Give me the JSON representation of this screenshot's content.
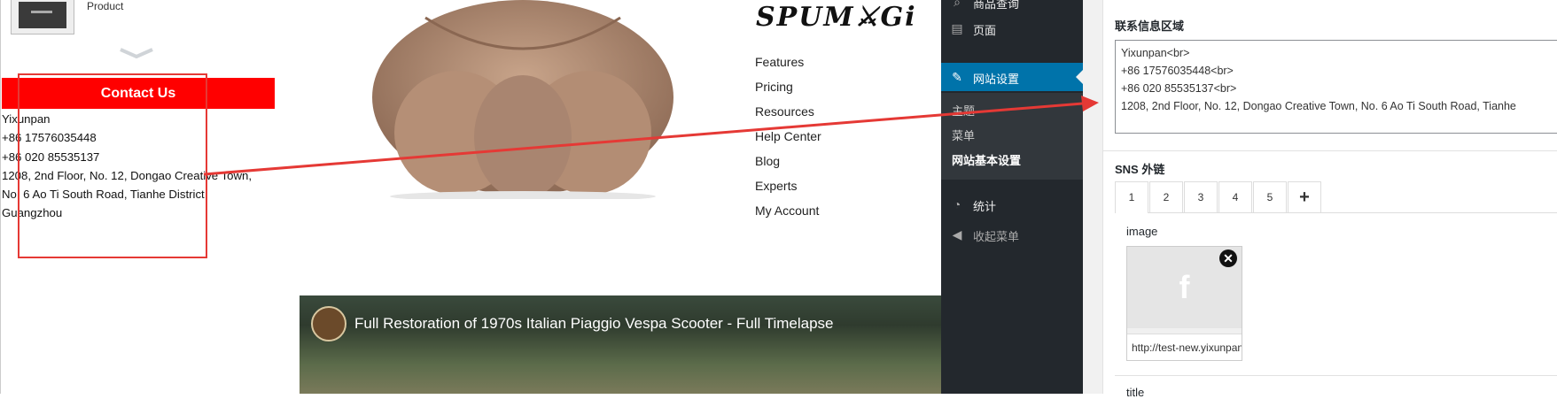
{
  "frontend": {
    "product_label": "Product",
    "contact_title": "Contact Us",
    "contact_lines": [
      "Yixunpan",
      "+86 17576035448",
      "+86 020 85535137",
      "1208, 2nd Floor, No. 12, Dongao Creative Town,",
      "No. 6 Ao Ti South Road, Tianhe District,",
      "Guangzhou"
    ],
    "logo_text": "SPUM⚔Gi",
    "footer_menu": [
      "Features",
      "Pricing",
      "Resources",
      "Help Center",
      "Blog",
      "Experts",
      "My Account"
    ],
    "video_title": "Full Restoration of 1970s Italian Piaggio Vespa Scooter - Full Timelapse"
  },
  "admin_sidebar": {
    "items": [
      {
        "label": "商品查询",
        "icon": "search-icon"
      },
      {
        "label": "页面",
        "icon": "page-icon"
      },
      {
        "label": "网站设置",
        "icon": "pin-icon",
        "active": true
      },
      {
        "label": "统计",
        "icon": "pie-chart-icon"
      },
      {
        "label": "收起菜单",
        "icon": "collapse-icon"
      }
    ],
    "submenu": [
      "主题",
      "菜单",
      "网站基本设置"
    ]
  },
  "settings": {
    "contact_section_label": "联系信息区域",
    "contact_textarea_lines": [
      "Yixunpan<br>",
      "+86 17576035448<br>",
      "+86 020 85535137<br>",
      "1208, 2nd Floor, No. 12, Dongao Creative Town, No. 6 Ao Ti South Road, Tianhe"
    ],
    "sns_label": "SNS 外链",
    "sns_tabs": [
      "1",
      "2",
      "3",
      "4",
      "5",
      "+"
    ],
    "image_label": "image",
    "image_url": "http://test-new.yixunpan",
    "title_label": "title"
  },
  "colors": {
    "contact_bar": "#ff0000",
    "annotation": "#e53935",
    "admin_bg": "#23282d",
    "admin_active": "#0073aa"
  }
}
